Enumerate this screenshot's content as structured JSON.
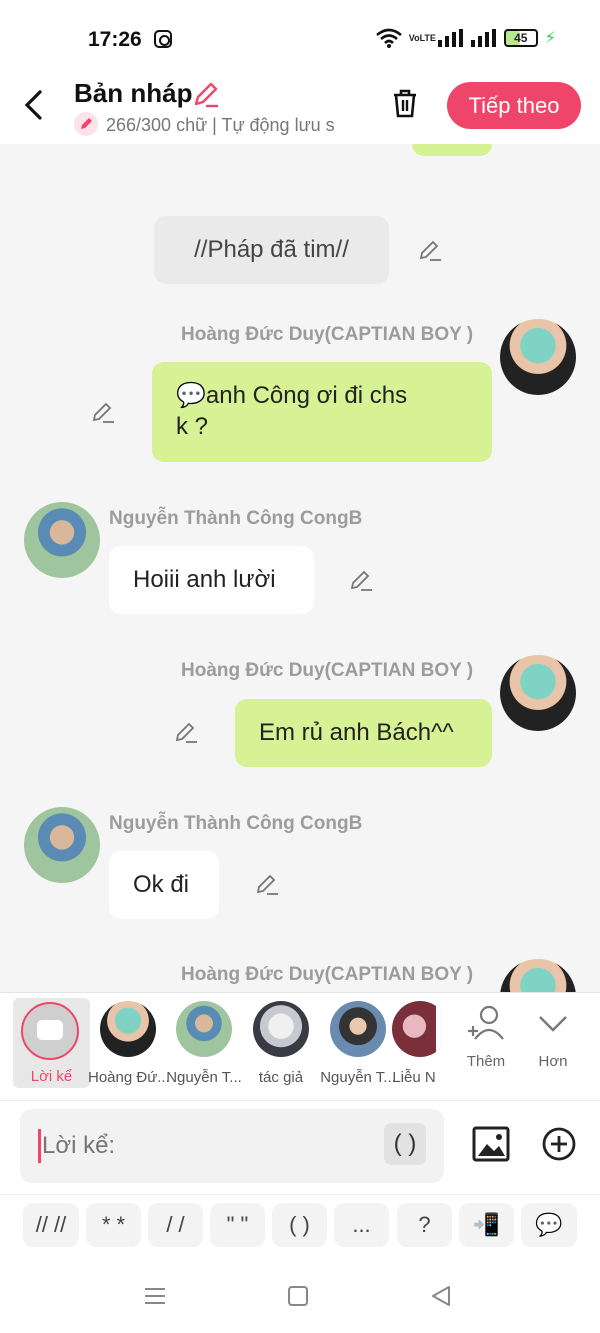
{
  "status": {
    "time": "17:26",
    "network": "VoLTE",
    "battery": "45"
  },
  "header": {
    "title": "Bản nháp",
    "subtitle": "266/300 chữ | Tự động lưu s",
    "next_label": "Tiếp theo"
  },
  "messages": {
    "m0": {
      "text": "//Pháp đã tim//"
    },
    "m1": {
      "author": "Hoàng Đức Duy(CAPTIAN BOY )",
      "text_line1": "💬anh Công ơi đi chs",
      "text_line2": "k ?"
    },
    "m2": {
      "author": "Nguyễn Thành Công CongB",
      "text": "Hoiii anh lười"
    },
    "m3": {
      "author": "Hoàng Đức Duy(CAPTIAN BOY )",
      "text": "Em rủ anh Bách^^"
    },
    "m4": {
      "author": "Nguyễn Thành Công CongB",
      "text": "Ok đi"
    },
    "m5": {
      "author": "Hoàng Đức Duy(CAPTIAN BOY )"
    }
  },
  "characters": {
    "narrator": "Lời kể",
    "items": [
      "Hoàng Đứ...",
      "Nguyễn T...",
      "tác giả",
      "Nguyễn T...",
      "Liễu N"
    ],
    "add_label": "Thêm",
    "more_label": "Hơn"
  },
  "composer": {
    "placeholder": "Lời kể:",
    "paren": "( )"
  },
  "symbols": [
    "// //",
    "* *",
    "/ /",
    "\" \"",
    "( )",
    "...",
    "?",
    "📲",
    "💬"
  ],
  "colors": {
    "accent": "#f0456a",
    "bubble_green": "#d6f294"
  }
}
